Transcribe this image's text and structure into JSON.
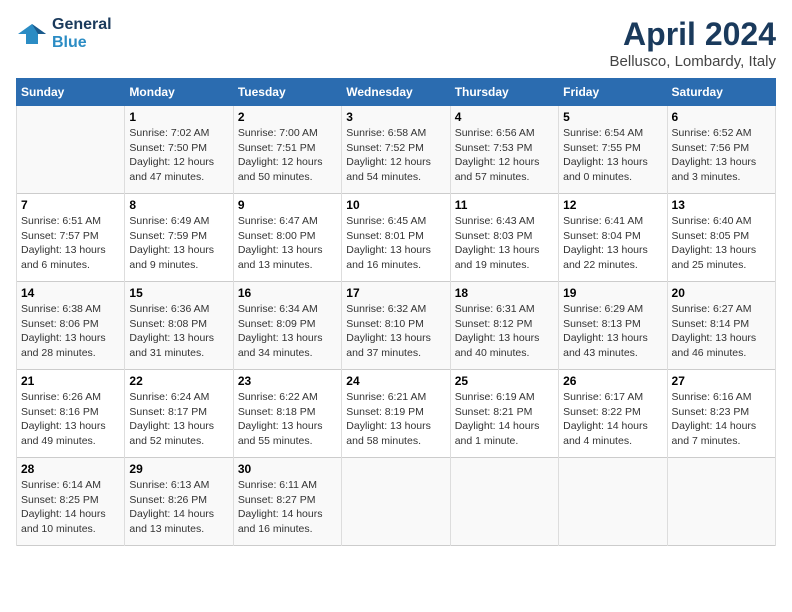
{
  "header": {
    "logo_line1": "General",
    "logo_line2": "Blue",
    "month_title": "April 2024",
    "location": "Bellusco, Lombardy, Italy"
  },
  "days_of_week": [
    "Sunday",
    "Monday",
    "Tuesday",
    "Wednesday",
    "Thursday",
    "Friday",
    "Saturday"
  ],
  "weeks": [
    [
      {
        "day": "",
        "detail": ""
      },
      {
        "day": "1",
        "detail": "Sunrise: 7:02 AM\nSunset: 7:50 PM\nDaylight: 12 hours\nand 47 minutes."
      },
      {
        "day": "2",
        "detail": "Sunrise: 7:00 AM\nSunset: 7:51 PM\nDaylight: 12 hours\nand 50 minutes."
      },
      {
        "day": "3",
        "detail": "Sunrise: 6:58 AM\nSunset: 7:52 PM\nDaylight: 12 hours\nand 54 minutes."
      },
      {
        "day": "4",
        "detail": "Sunrise: 6:56 AM\nSunset: 7:53 PM\nDaylight: 12 hours\nand 57 minutes."
      },
      {
        "day": "5",
        "detail": "Sunrise: 6:54 AM\nSunset: 7:55 PM\nDaylight: 13 hours\nand 0 minutes."
      },
      {
        "day": "6",
        "detail": "Sunrise: 6:52 AM\nSunset: 7:56 PM\nDaylight: 13 hours\nand 3 minutes."
      }
    ],
    [
      {
        "day": "7",
        "detail": "Sunrise: 6:51 AM\nSunset: 7:57 PM\nDaylight: 13 hours\nand 6 minutes."
      },
      {
        "day": "8",
        "detail": "Sunrise: 6:49 AM\nSunset: 7:59 PM\nDaylight: 13 hours\nand 9 minutes."
      },
      {
        "day": "9",
        "detail": "Sunrise: 6:47 AM\nSunset: 8:00 PM\nDaylight: 13 hours\nand 13 minutes."
      },
      {
        "day": "10",
        "detail": "Sunrise: 6:45 AM\nSunset: 8:01 PM\nDaylight: 13 hours\nand 16 minutes."
      },
      {
        "day": "11",
        "detail": "Sunrise: 6:43 AM\nSunset: 8:03 PM\nDaylight: 13 hours\nand 19 minutes."
      },
      {
        "day": "12",
        "detail": "Sunrise: 6:41 AM\nSunset: 8:04 PM\nDaylight: 13 hours\nand 22 minutes."
      },
      {
        "day": "13",
        "detail": "Sunrise: 6:40 AM\nSunset: 8:05 PM\nDaylight: 13 hours\nand 25 minutes."
      }
    ],
    [
      {
        "day": "14",
        "detail": "Sunrise: 6:38 AM\nSunset: 8:06 PM\nDaylight: 13 hours\nand 28 minutes."
      },
      {
        "day": "15",
        "detail": "Sunrise: 6:36 AM\nSunset: 8:08 PM\nDaylight: 13 hours\nand 31 minutes."
      },
      {
        "day": "16",
        "detail": "Sunrise: 6:34 AM\nSunset: 8:09 PM\nDaylight: 13 hours\nand 34 minutes."
      },
      {
        "day": "17",
        "detail": "Sunrise: 6:32 AM\nSunset: 8:10 PM\nDaylight: 13 hours\nand 37 minutes."
      },
      {
        "day": "18",
        "detail": "Sunrise: 6:31 AM\nSunset: 8:12 PM\nDaylight: 13 hours\nand 40 minutes."
      },
      {
        "day": "19",
        "detail": "Sunrise: 6:29 AM\nSunset: 8:13 PM\nDaylight: 13 hours\nand 43 minutes."
      },
      {
        "day": "20",
        "detail": "Sunrise: 6:27 AM\nSunset: 8:14 PM\nDaylight: 13 hours\nand 46 minutes."
      }
    ],
    [
      {
        "day": "21",
        "detail": "Sunrise: 6:26 AM\nSunset: 8:16 PM\nDaylight: 13 hours\nand 49 minutes."
      },
      {
        "day": "22",
        "detail": "Sunrise: 6:24 AM\nSunset: 8:17 PM\nDaylight: 13 hours\nand 52 minutes."
      },
      {
        "day": "23",
        "detail": "Sunrise: 6:22 AM\nSunset: 8:18 PM\nDaylight: 13 hours\nand 55 minutes."
      },
      {
        "day": "24",
        "detail": "Sunrise: 6:21 AM\nSunset: 8:19 PM\nDaylight: 13 hours\nand 58 minutes."
      },
      {
        "day": "25",
        "detail": "Sunrise: 6:19 AM\nSunset: 8:21 PM\nDaylight: 14 hours\nand 1 minute."
      },
      {
        "day": "26",
        "detail": "Sunrise: 6:17 AM\nSunset: 8:22 PM\nDaylight: 14 hours\nand 4 minutes."
      },
      {
        "day": "27",
        "detail": "Sunrise: 6:16 AM\nSunset: 8:23 PM\nDaylight: 14 hours\nand 7 minutes."
      }
    ],
    [
      {
        "day": "28",
        "detail": "Sunrise: 6:14 AM\nSunset: 8:25 PM\nDaylight: 14 hours\nand 10 minutes."
      },
      {
        "day": "29",
        "detail": "Sunrise: 6:13 AM\nSunset: 8:26 PM\nDaylight: 14 hours\nand 13 minutes."
      },
      {
        "day": "30",
        "detail": "Sunrise: 6:11 AM\nSunset: 8:27 PM\nDaylight: 14 hours\nand 16 minutes."
      },
      {
        "day": "",
        "detail": ""
      },
      {
        "day": "",
        "detail": ""
      },
      {
        "day": "",
        "detail": ""
      },
      {
        "day": "",
        "detail": ""
      }
    ]
  ]
}
